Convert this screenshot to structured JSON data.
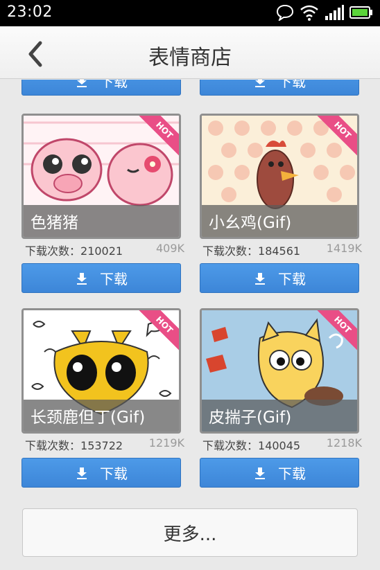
{
  "status_bar": {
    "time": "23:02"
  },
  "header": {
    "title": "表情商店"
  },
  "download_label": "下载",
  "download_count_prefix": "下载次数：",
  "hot_label": "HOT",
  "items": [
    {
      "name": "色猪猪",
      "count": "210021",
      "size": "409K",
      "hot": true
    },
    {
      "name": "小幺鸡(Gif)",
      "count": "184561",
      "size": "1419K",
      "hot": true
    },
    {
      "name": "长颈鹿但丁(Gif)",
      "count": "153722",
      "size": "1219K",
      "hot": true
    },
    {
      "name": "皮揣子(Gif)",
      "count": "140045",
      "size": "1218K",
      "hot": true
    }
  ],
  "more_button": {
    "label": "更多..."
  },
  "colors": {
    "accent": "#3d86d8",
    "hot": "#e94e86",
    "status_bar": "#000000"
  }
}
